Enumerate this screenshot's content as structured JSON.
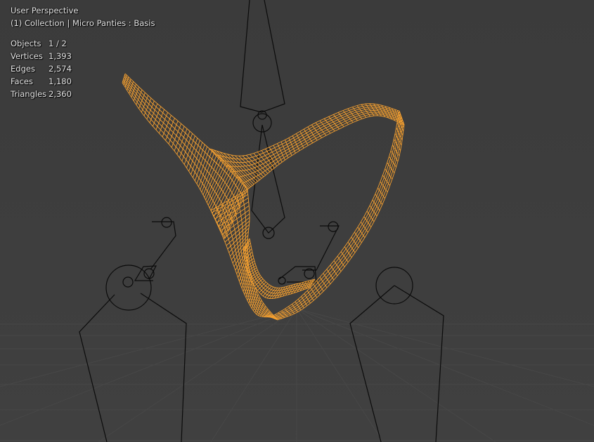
{
  "viewport": {
    "view_name": "User Perspective",
    "collection_line": "(1) Collection | Micro Panties : Basis",
    "statistics": [
      {
        "label": "Objects",
        "value": "1 / 2"
      },
      {
        "label": "Vertices",
        "value": "1,393"
      },
      {
        "label": "Edges",
        "value": "2,574"
      },
      {
        "label": "Faces",
        "value": "1,180"
      },
      {
        "label": "Triangles",
        "value": "2,360"
      }
    ]
  },
  "colors": {
    "background": "#3d3d3d",
    "grid": "#4a4a4a",
    "selected_wire": "#f5a030",
    "rig_lines": "#0a0a0a"
  }
}
